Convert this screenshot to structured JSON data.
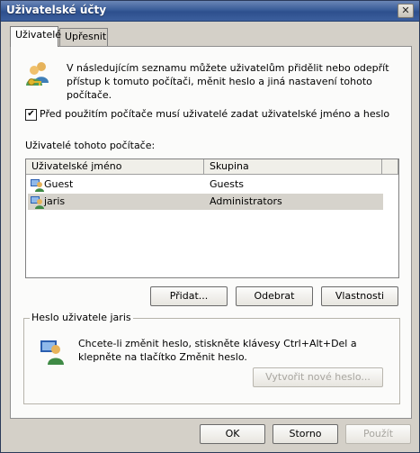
{
  "window": {
    "title": "Uživatelské účty",
    "close_glyph": "✕"
  },
  "tabs": [
    {
      "label": "Uživatelé"
    },
    {
      "label": "Upřesnit"
    }
  ],
  "info": {
    "text": "V následujícím seznamu můžete uživatelům přidělit nebo odepřít přístup k tomuto počítači, měnit heslo a jiná nastavení tohoto počítače.",
    "icon": "users-key-icon"
  },
  "require_login": {
    "checked": true,
    "check_glyph": "✔",
    "label": "Před použitím počítače musí uživatelé zadat uživatelské jméno a heslo"
  },
  "users": {
    "label": "Uživatelé tohoto počítače:",
    "columns": [
      "Uživatelské jméno",
      "Skupina"
    ],
    "rows": [
      {
        "name": "Guest",
        "group": "Guests",
        "icon": "user-icon"
      },
      {
        "name": "jaris",
        "group": "Administrators",
        "icon": "user-icon",
        "selected": true
      }
    ]
  },
  "user_buttons": {
    "add": "Přidat...",
    "remove": "Odebrat",
    "properties": "Vlastnosti"
  },
  "password_group": {
    "title": "Heslo uživatele jaris",
    "text": "Chcete-li změnit heslo, stiskněte klávesy Ctrl+Alt+Del a klepněte na tlačítko Změnit heslo.",
    "button": "Vytvořit nové heslo...",
    "icon": "user-password-icon"
  },
  "dialog_buttons": {
    "ok": "OK",
    "cancel": "Storno",
    "apply": "Použít"
  }
}
